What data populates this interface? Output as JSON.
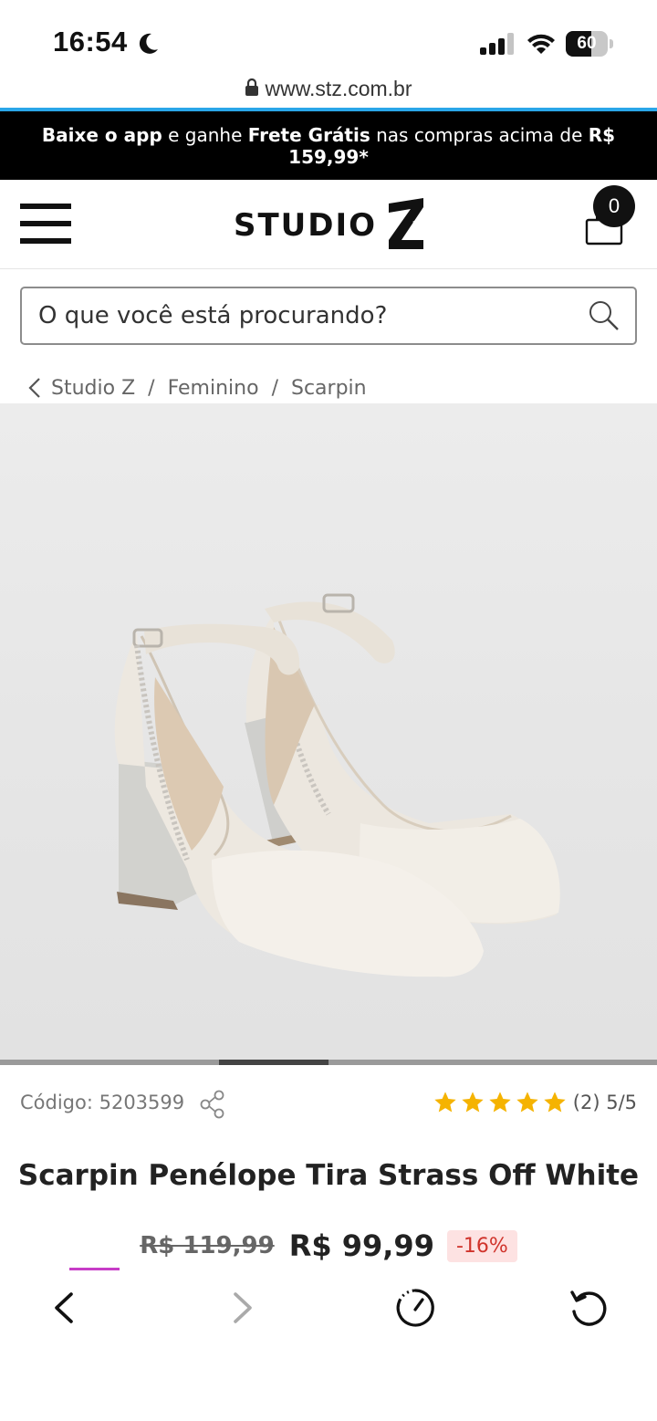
{
  "status_bar": {
    "time": "16:54",
    "battery": "60",
    "battery_level": 0.6
  },
  "browser": {
    "url": "www.stz.com.br"
  },
  "promo": {
    "bold1": "Baixe o app",
    "text1": " e ganhe ",
    "bold2": "Frete Grátis",
    "text2": " nas compras acima de ",
    "bold3": "R$ 159,99*"
  },
  "header": {
    "logo_text": "STUDIO",
    "cart_count": "0"
  },
  "search": {
    "placeholder": "O que você está procurando?"
  },
  "breadcrumb": {
    "items": [
      "Studio Z",
      "Feminino",
      "Scarpin"
    ],
    "separator": "/"
  },
  "carousel": {
    "active_index": 2,
    "total": 6
  },
  "product": {
    "code_label": "Código: 5203599",
    "rating_stars": 5,
    "rating_text": "(2) 5/5",
    "title": "Scarpin Penélope Tira Strass Off White",
    "old_price": "R$ 119,99",
    "price": "R$ 99,99",
    "discount": "-16%"
  },
  "colors": {
    "banner_bg": "#000000",
    "star": "#f5b301",
    "discount_text": "#d0342c",
    "discount_bg": "#fde2e2",
    "accent": "#c73cc7",
    "url_progress": "#2aa6e8"
  },
  "icons": {
    "status": [
      "moon-icon",
      "signal-icon",
      "wifi-icon",
      "battery-icon"
    ],
    "header": [
      "menu-icon",
      "cart-icon"
    ],
    "toolbar": [
      "back-icon",
      "forward-icon",
      "speed-icon",
      "refresh-icon"
    ]
  }
}
